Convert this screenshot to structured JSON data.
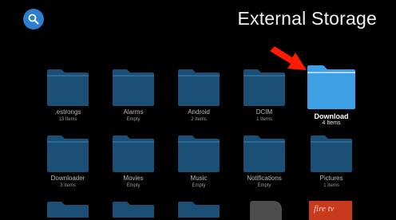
{
  "header": {
    "title": "External Storage",
    "search_icon": "search-icon"
  },
  "folders": [
    {
      "name": ".estrongs",
      "count": "13 Items"
    },
    {
      "name": "Alarms",
      "count": "Empty"
    },
    {
      "name": "Android",
      "count": "2 Items"
    },
    {
      "name": "DCIM",
      "count": "1 Items"
    },
    {
      "name": "Download",
      "count": "4 Items",
      "selected": true
    },
    {
      "name": "Downloader",
      "count": "3 Items"
    },
    {
      "name": "Movies",
      "count": "Empty"
    },
    {
      "name": "Music",
      "count": "Empty"
    },
    {
      "name": "Notifications",
      "count": "Empty"
    },
    {
      "name": "Pictures",
      "count": "1 Items"
    }
  ],
  "partial_row_visible": {
    "fire_tv_label": "fire tv"
  },
  "colors": {
    "folder": "#1b4f75",
    "folder_selected": "#3fa0e6",
    "accent": "#2b7fd0",
    "arrow": "#ff1a00"
  }
}
